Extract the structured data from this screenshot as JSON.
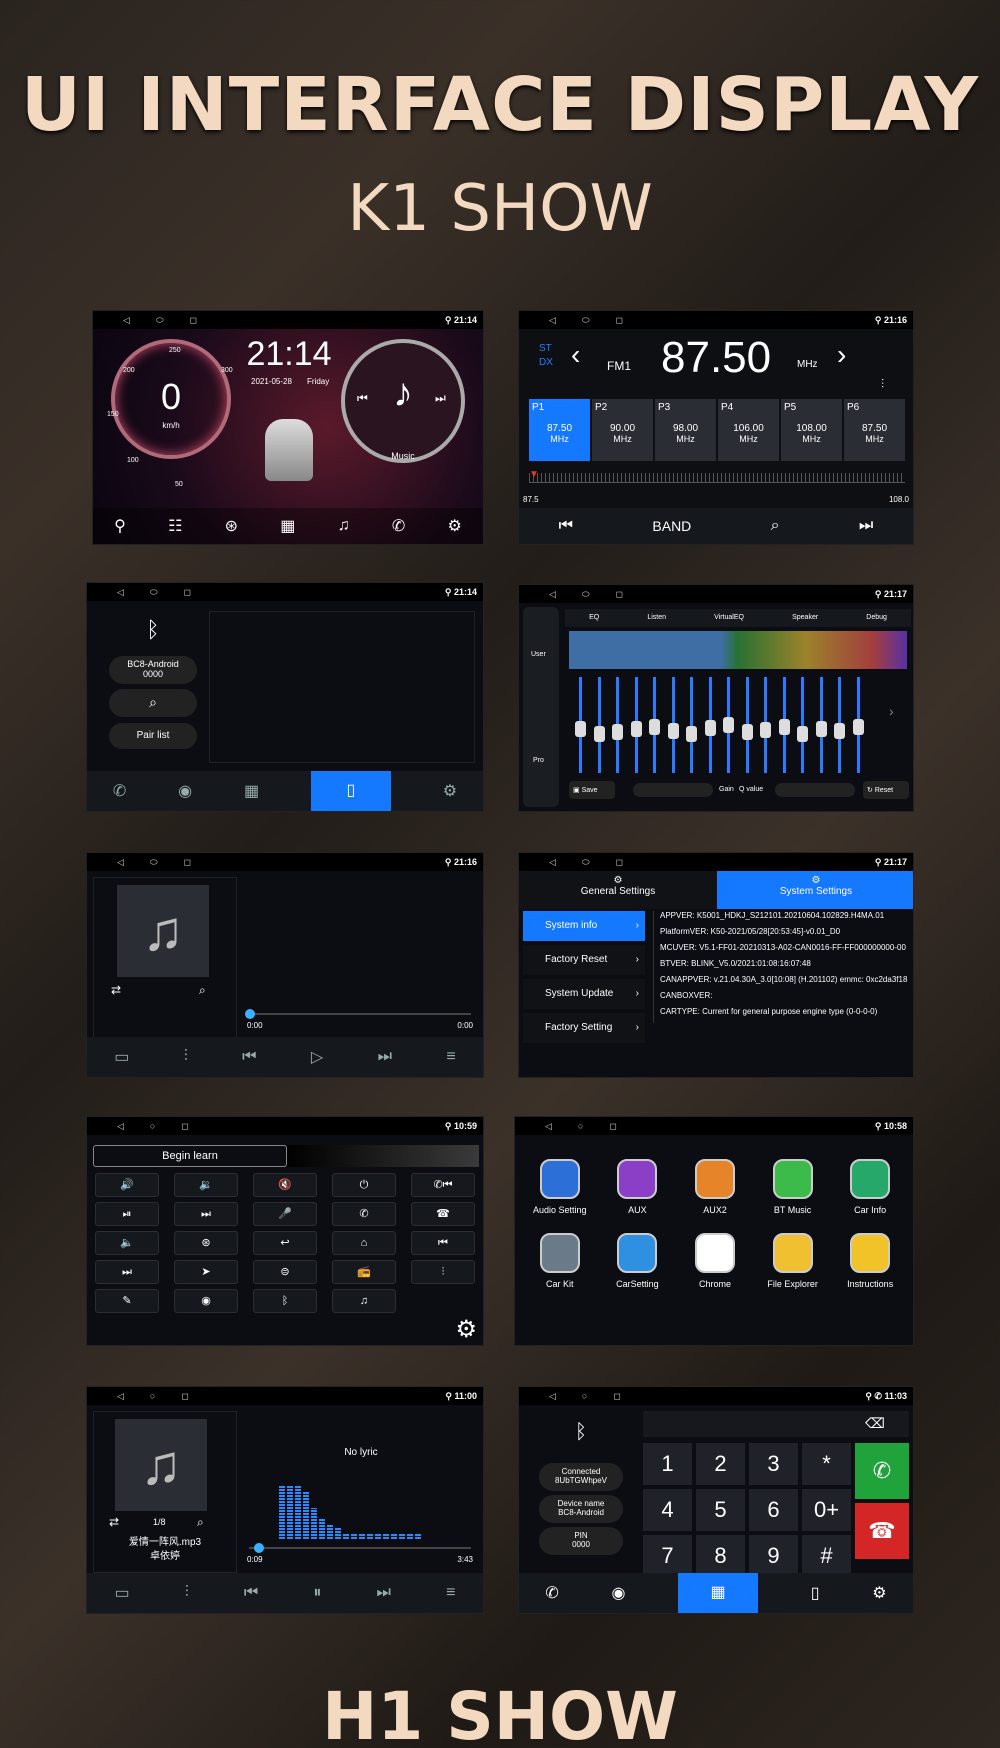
{
  "header": {
    "title": "UI INTERFACE DISPLAY",
    "subtitle": "K1 SHOW",
    "footer": "H1 SHOW"
  },
  "s1": {
    "time": "21:14",
    "clock": "21:14",
    "date": "2021-05-28",
    "day": "Friday",
    "speed": "0",
    "unit": "km/h",
    "ticks": [
      "250",
      "200",
      "300",
      "150",
      "100",
      "50"
    ],
    "music": "Music"
  },
  "s2": {
    "time": "21:16",
    "st": "ST",
    "dx": "DX",
    "band_label": "FM1",
    "freq": "87.50",
    "unit": "MHz",
    "presets": [
      {
        "p": "P1",
        "f": "87.50",
        "u": "MHz"
      },
      {
        "p": "P2",
        "f": "90.00",
        "u": "MHz"
      },
      {
        "p": "P3",
        "f": "98.00",
        "u": "MHz"
      },
      {
        "p": "P4",
        "f": "106.00",
        "u": "MHz"
      },
      {
        "p": "P5",
        "f": "108.00",
        "u": "MHz"
      },
      {
        "p": "P6",
        "f": "87.50",
        "u": "MHz"
      }
    ],
    "min": "87.5",
    "max": "108.0",
    "band": "BAND"
  },
  "s3": {
    "time": "21:14",
    "device": "BC8-Android",
    "pin": "0000",
    "pairlist": "Pair list"
  },
  "s4": {
    "time": "21:17",
    "tabs": [
      "EQ",
      "Listen",
      "VirtualEQ",
      "Speaker",
      "Debug"
    ],
    "user": "User",
    "pro": "Pro",
    "save": "Save",
    "gain": "Gain",
    "q": "Q value",
    "reset": "Reset",
    "sliders": [
      0.85,
      0.8,
      0.82,
      0.85,
      0.88,
      0.83,
      0.8,
      0.86,
      0.9,
      0.82,
      0.84,
      0.88,
      0.8,
      0.85,
      0.83,
      0.87
    ]
  },
  "s5": {
    "time": "21:16",
    "start": "0:00",
    "end": "0:00"
  },
  "s6": {
    "time": "21:17",
    "tab1": "General Settings",
    "tab2": "System Settings",
    "menu": [
      "System info",
      "Factory Reset",
      "System Update",
      "Factory Setting"
    ],
    "info": [
      "APPVER: K5001_HDKJ_S212101.20210604.102829.H4MA.01",
      "PlatformVER: K50-2021/05/28[20:53:45]-v0.01_D0",
      "MCUVER: V5.1-FF01-20210313-A02-CAN0016-FF-FF000000000-00",
      "BTVER: BLINK_V5.0/2021:01:08:16:07:48",
      "CANAPPVER: v.21.04.30A_3.0[10:08] (H.201102)  emmc: 0xc2da3f18",
      "CANBOXVER:",
      "CARTYPE: Current for general purpose engine type (0-0-0-0)"
    ]
  },
  "s7": {
    "time": "10:59",
    "learn": "Begin learn"
  },
  "s8": {
    "time": "10:58",
    "apps": [
      "Audio Setting",
      "AUX",
      "AUX2",
      "BT Music",
      "Car Info",
      "Car Kit",
      "CarSetting",
      "Chrome",
      "File Explorer",
      "Instructions"
    ],
    "colors": [
      "#2c6fd6",
      "#8b3fc6",
      "#e6842a",
      "#3dbb4a",
      "#27a86b",
      "#6b7a88",
      "#2f8fe0",
      "#ffffff",
      "#f0c030",
      "#f2c229"
    ]
  },
  "s9": {
    "time": "11:00",
    "lyric": "No lyric",
    "track": "1/8",
    "song": "爱情一阵风.mp3",
    "artist": "卓依婷",
    "start": "0:09",
    "end": "3:43"
  },
  "s10": {
    "time": "11:03",
    "status": "Connected",
    "dev": "8UbTGWhpeV",
    "devlabel": "Device name",
    "devname": "BC8-Android",
    "pinlabel": "PIN",
    "pin": "0000",
    "keys": [
      "1",
      "2",
      "3",
      "*",
      "4",
      "5",
      "6",
      "0+",
      "7",
      "8",
      "9",
      "#"
    ]
  }
}
